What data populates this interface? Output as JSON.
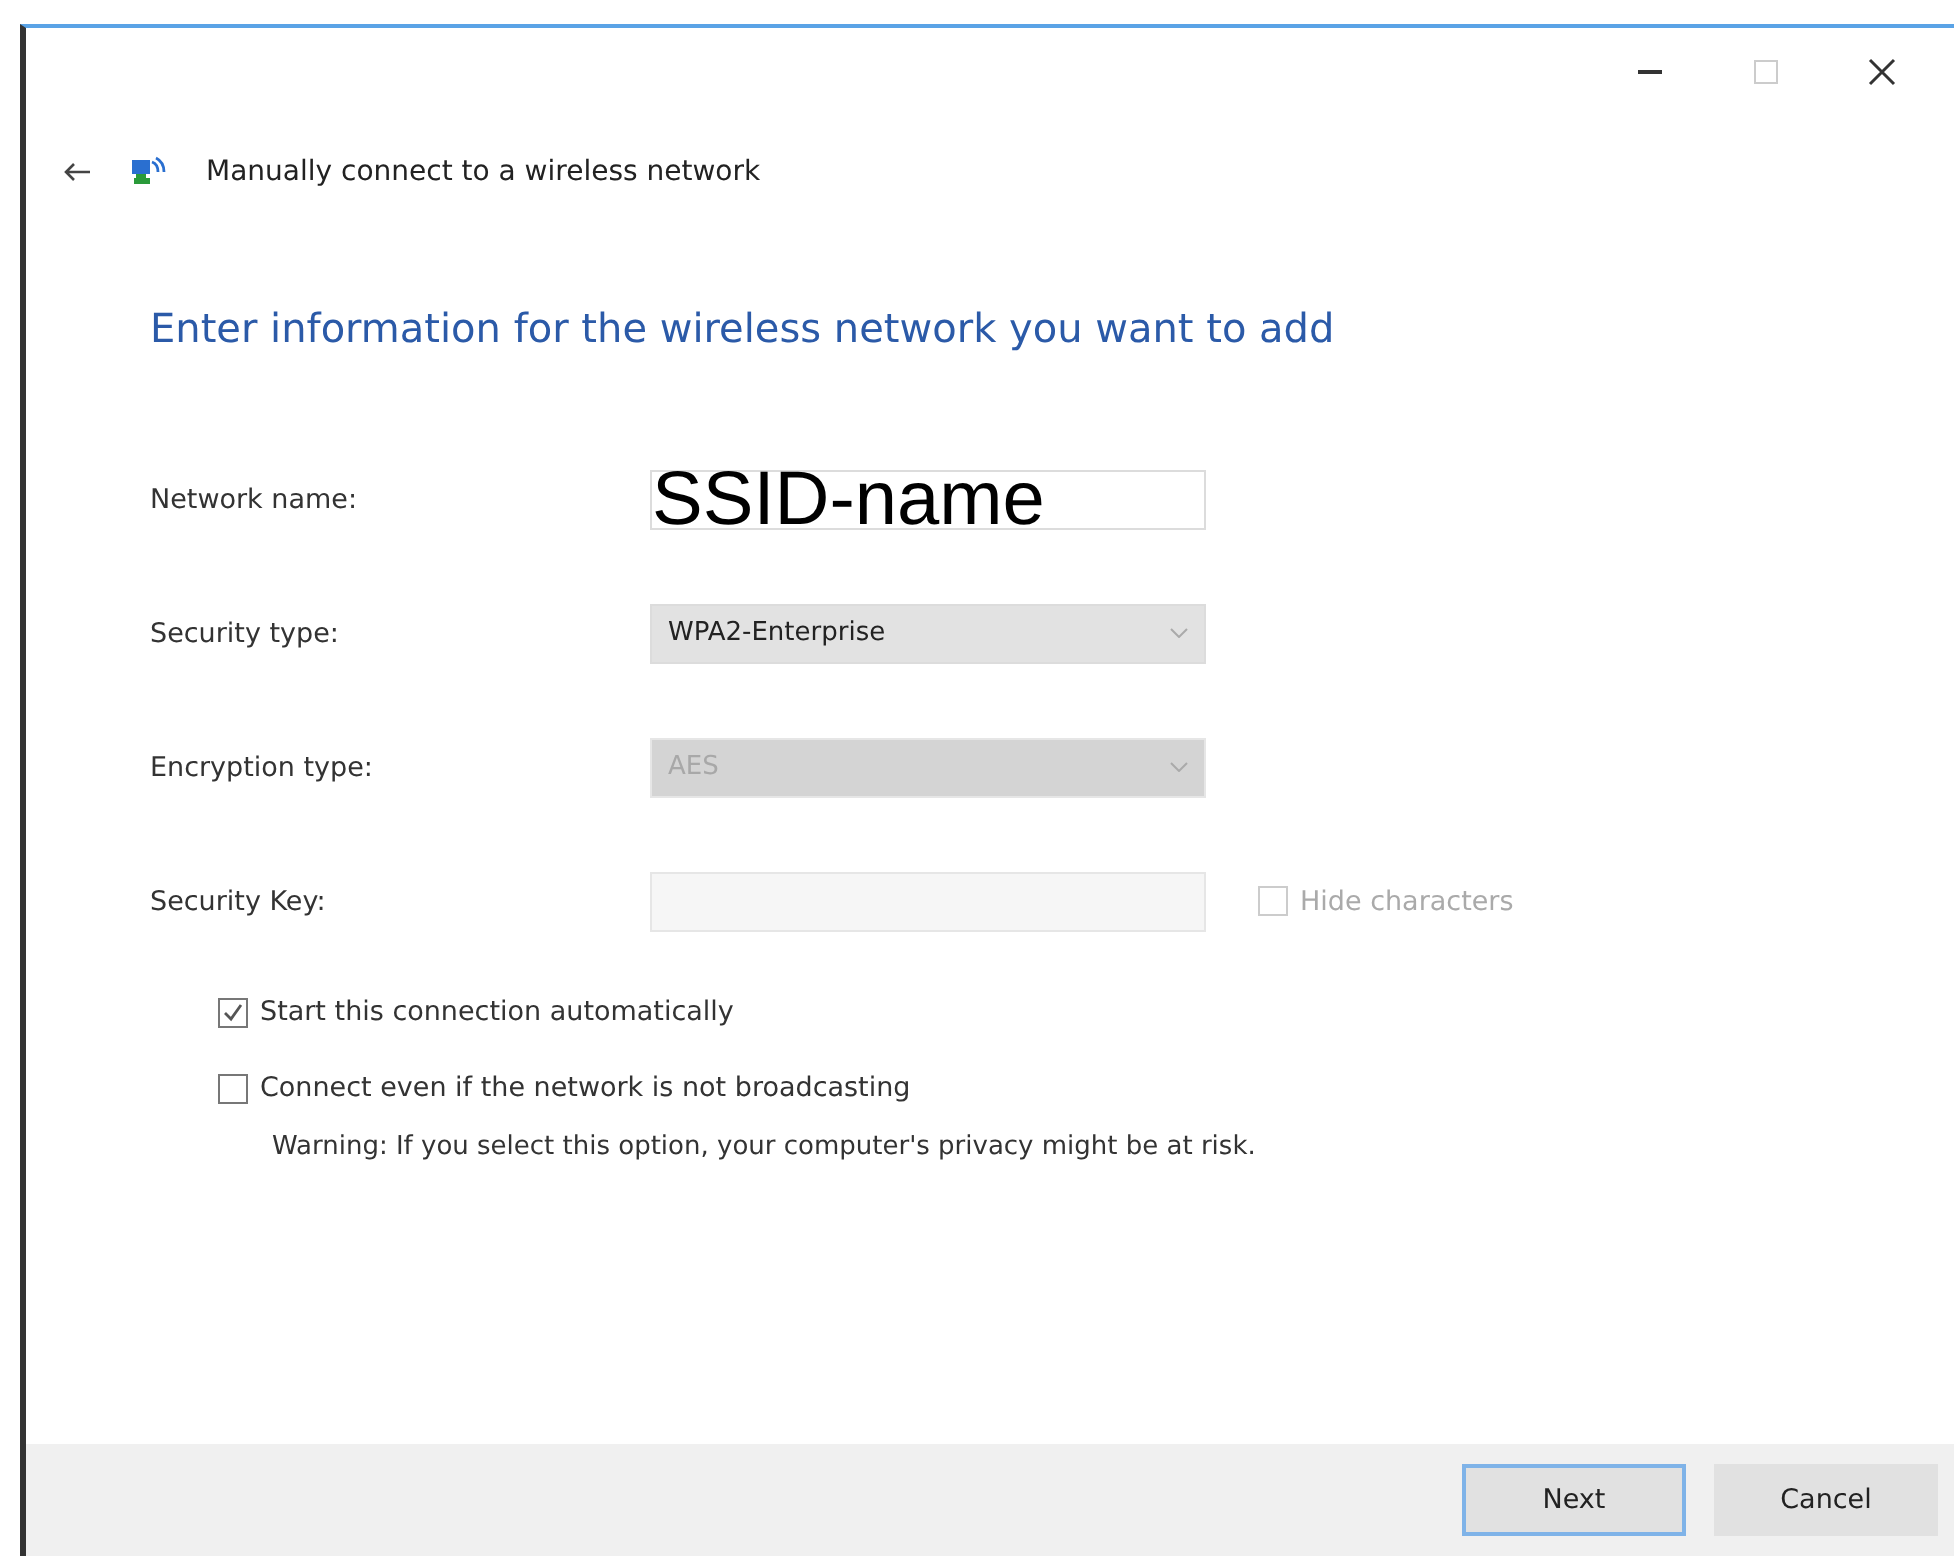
{
  "window": {
    "title": "Manually connect to a wireless network"
  },
  "heading": "Enter information for the wireless network you want to add",
  "fields": [
    {
      "kind": "text",
      "label": "Network name:",
      "value": "SSID-name",
      "disabled": false
    },
    {
      "kind": "dropdown",
      "label": "Security type:",
      "value": "WPA2-Enterprise",
      "disabled": false
    },
    {
      "kind": "dropdown",
      "label": "Encryption type:",
      "value": "AES",
      "disabled": true
    },
    {
      "kind": "text",
      "label": "Security Key:",
      "disabled": true,
      "option": {
        "label": "Hide characters",
        "checked": false,
        "disabled": true
      }
    }
  ],
  "options": [
    {
      "label": "Start this connection automatically",
      "checked": true
    },
    {
      "label": "Connect even if the network is not broadcasting",
      "checked": false,
      "note": "Warning: If you select this option, your computer's privacy might be at risk."
    }
  ],
  "buttons": [
    {
      "label": "Next",
      "default": true
    },
    {
      "label": "Cancel",
      "default": false
    }
  ]
}
